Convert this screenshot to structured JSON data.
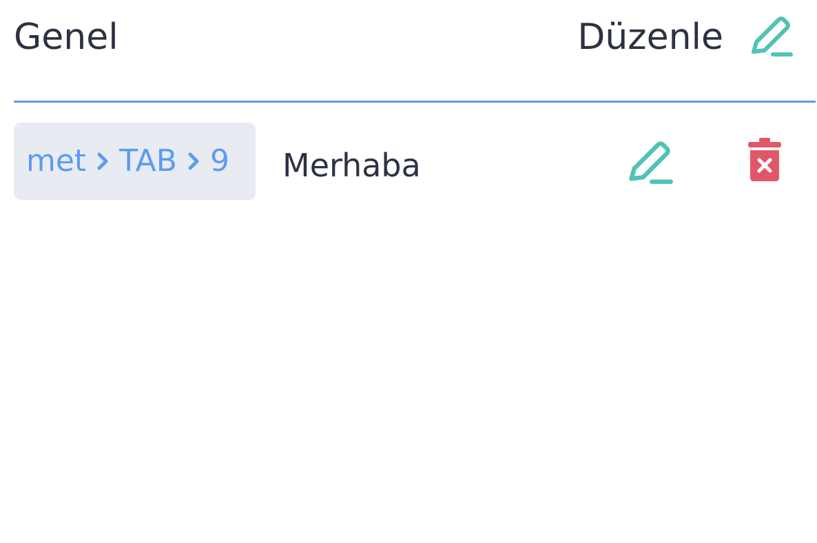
{
  "header": {
    "title": "Genel",
    "edit_label": "Düzenle",
    "edit_icon": "pencil-icon"
  },
  "shortcuts": [
    {
      "keys": [
        "met",
        "TAB",
        "9"
      ],
      "text": "Merhaba",
      "edit_icon": "pencil-icon",
      "delete_icon": "trash-icon"
    }
  ],
  "colors": {
    "accent_blue": "#5b9cf0",
    "teal": "#4fc3b4",
    "danger_red": "#e0576a",
    "text_dark": "#2d3142",
    "chip_bg": "#e8ebf1"
  }
}
